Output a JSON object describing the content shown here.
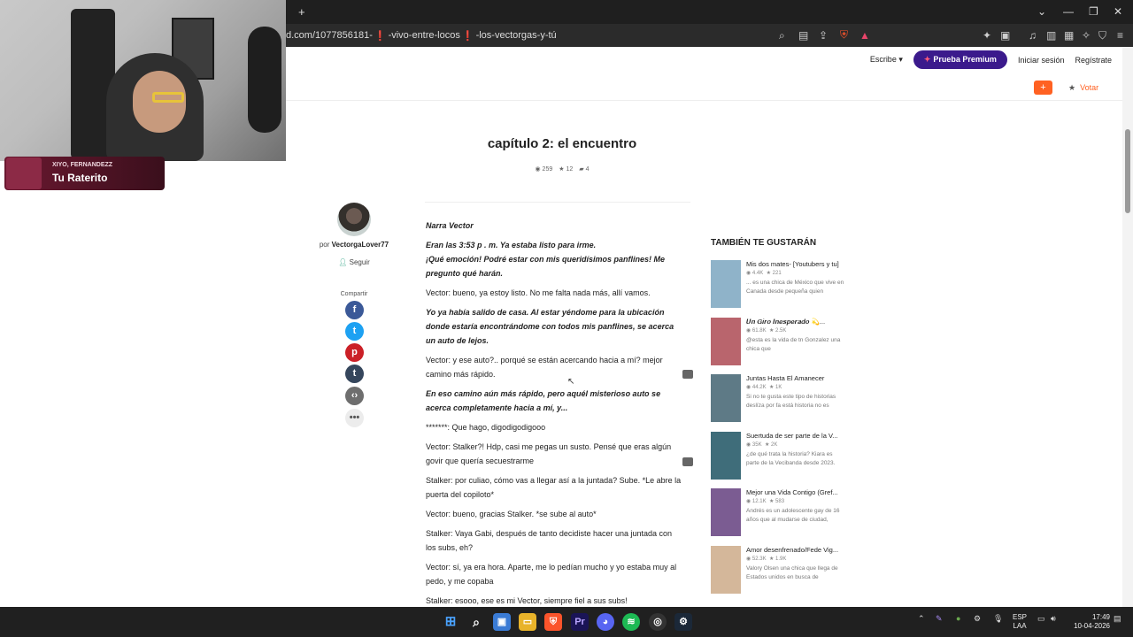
{
  "browser": {
    "new_tab": "+",
    "url_parts": [
      "d.com/1077856181-",
      "-vivo-entre-locos",
      "-los-vectorgas-y-tú"
    ],
    "url_sep": "❗"
  },
  "header": {
    "write_label": "Escribe",
    "premium_label": "Prueba Premium",
    "login_label": "Iniciar sesión",
    "register_label": "Regístrate",
    "plus_label": "+",
    "vote_label": "Votar"
  },
  "chapter": {
    "title": "capítulo 2: el encuentro",
    "reads": "259",
    "votes": "12",
    "comments": "4"
  },
  "author": {
    "by": "por",
    "name": "VectorgaLover77",
    "follow_label": "Seguir",
    "share_label": "Compartir"
  },
  "story": [
    {
      "text": "Narra Vector",
      "italic": true
    },
    {
      "text": "Eran las 3:53 p . m. Ya estaba listo para irme.\n¡Qué emoción! Podré estar con mis queridísimos panflines! Me pregunto qué harán.",
      "italic": true
    },
    {
      "text": "Vector: bueno, ya estoy listo. No me falta nada más, allí vamos.",
      "italic": false
    },
    {
      "text": "Yo ya había salido de casa. Al estar yéndome para la ubicación donde estaría encontrándome con todos mis panflines, se acerca un auto de lejos.",
      "italic": true
    },
    {
      "text": "Vector: y ese auto?.. porqué se están acercando hacia a mí? mejor camino más rápido.",
      "italic": false
    },
    {
      "text": "En eso camino aún más rápido, pero aquél misterioso auto se acerca completamente hacia a mí, y...",
      "italic": true
    },
    {
      "text": "*******: Que hago, digodigodigooo",
      "italic": false
    },
    {
      "text": "Vector: Stalker?! Hdp, casi me pegas un susto. Pensé que eras algún govir que quería secuestrarme",
      "italic": false
    },
    {
      "text": "Stalker: por culiao, cómo vas a llegar así a la juntada? Sube. *Le abre la puerta del copiloto*",
      "italic": false
    },
    {
      "text": "Vector: bueno, gracias Stalker. *se sube al auto*",
      "italic": false
    },
    {
      "text": "Stalker: Vaya Gabi, después de tanto decidiste hacer una juntada con los subs, eh?",
      "italic": false
    },
    {
      "text": "Vector: sí, ya era hora. Aparte, me lo pedían mucho y yo estaba muy al pedo, y me copaba",
      "italic": false
    },
    {
      "text": "Stalker: esooo, ese es mi Vector, siempre fiel a sus subs!",
      "italic": false
    }
  ],
  "sidebar": {
    "title": "TAMBIÉN TE GUSTARÁN",
    "items": [
      {
        "title": "Mis dos mates- [Youtubers y tu]",
        "reads": "4.4K",
        "votes": "221",
        "desc": "... es una chica de México que vive en Canada desde pequeña quien",
        "color": "#8fb3c9"
      },
      {
        "title": "𝑼𝒏 𝑮𝒊𝒓𝒐 𝑰𝒏𝒆𝒔𝒑𝒆𝒓𝒂𝒅𝒐 💫...",
        "reads": "61.8K",
        "votes": "2.5K",
        "desc": "@esta es la vida de tn Gonzalez una chica que",
        "color": "#b9656d"
      },
      {
        "title": "Juntas Hasta El Amanecer",
        "reads": "44.2K",
        "votes": "1K",
        "desc": "Si no te gusta este tipo de historias deslíza por fa está historia no es",
        "color": "#5e7a86"
      },
      {
        "title": "Suertuda de ser parte de la V...",
        "reads": "35K",
        "votes": "2K",
        "desc": "¿de qué trata la historia? Kiara es parte de la Vecibanda desde 2023.",
        "color": "#3f6d7a"
      },
      {
        "title": "Mejor una Vida Contigo (Gref...",
        "reads": "12.1K",
        "votes": "583",
        "desc": "Andrés es un adolescente gay de 16 años que al mudarse de ciudad,",
        "color": "#7b5c92"
      },
      {
        "title": "Amor desenfrenado/Fede Vig...",
        "reads": "52.3K",
        "votes": "1.9K",
        "desc": "Valory Olsen una chica que llega de Estados unidos en busca de",
        "color": "#d4b79a"
      }
    ]
  },
  "stream_overlay": {
    "artist": "XIYO, FERNANDEZZ",
    "song": "Tu Raterito"
  },
  "taskbar": {
    "lang_top": "ESP",
    "lang_bottom": "LAA",
    "time": "17:49",
    "date": "10-04-2026"
  }
}
